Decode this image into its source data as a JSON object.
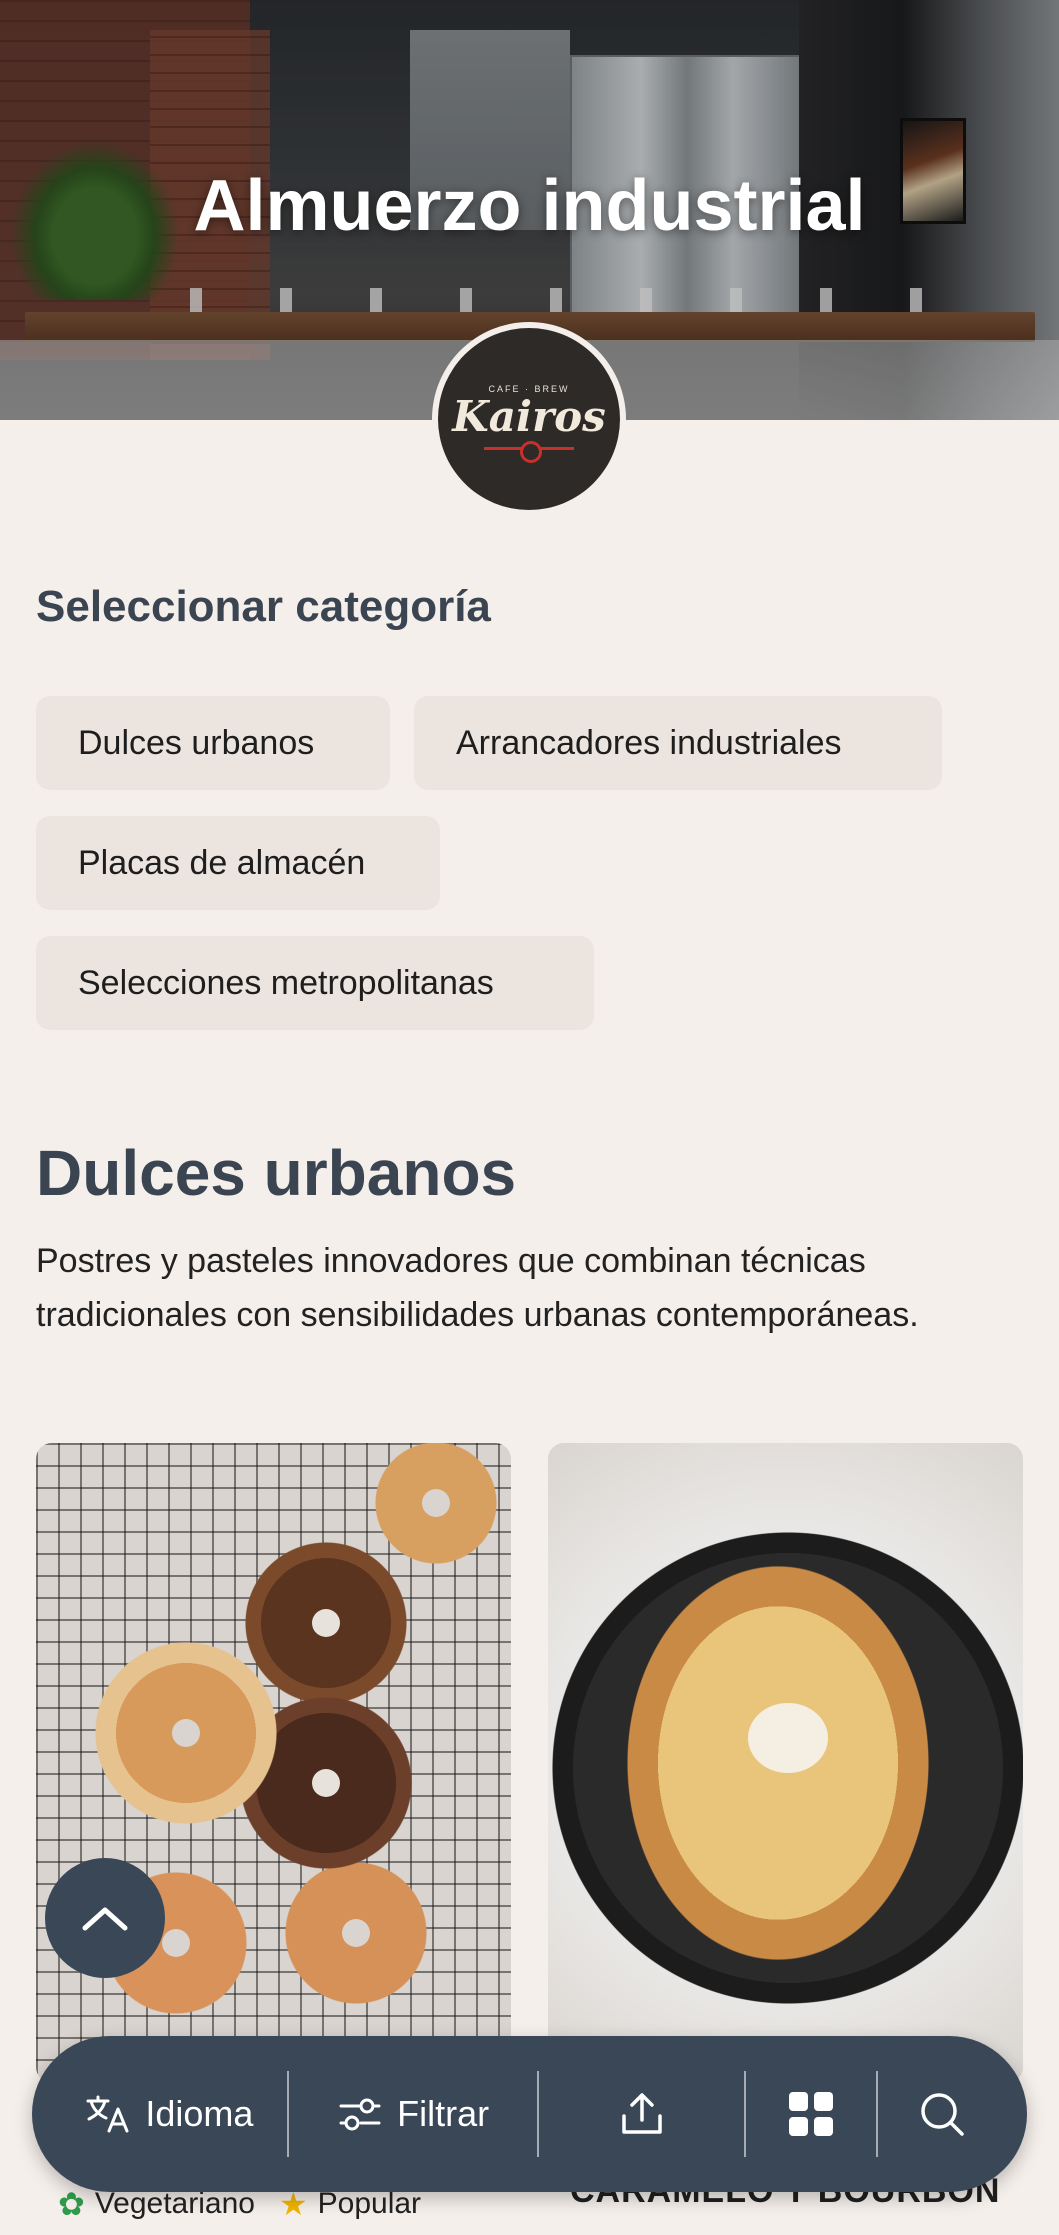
{
  "hero": {
    "title": "Almuerzo industrial"
  },
  "logo": {
    "small_text": "CAFE · BREW",
    "name": "Kairos"
  },
  "categories": {
    "heading": "Seleccionar categoría",
    "chips": [
      "Dulces urbanos",
      "Arrancadores industriales",
      "Placas de almacén",
      "Selecciones metropolitanas"
    ]
  },
  "section": {
    "title": "Dulces urbanos",
    "description": "Postres y pasteles innovadores que combinan técnicas tradicionales con sensibilidades urbanas contemporáneas."
  },
  "cards": {
    "left": {
      "tags": [
        "Vegetariano",
        "Popular"
      ]
    },
    "right": {
      "title": "CARAMELO Y BOURBON"
    }
  },
  "bottom_bar": {
    "language_label": "Idioma",
    "filter_label": "Filtrar",
    "icons": [
      "translate-icon",
      "filter-icon",
      "share-icon",
      "grid-icon",
      "search-icon"
    ]
  },
  "colors": {
    "background": "#f5efeb",
    "bar": "#3a4757",
    "heading": "#3b4552",
    "chip": "#ece4df",
    "accent_leaf": "#2e9b4a",
    "accent_star": "#f0b400"
  }
}
